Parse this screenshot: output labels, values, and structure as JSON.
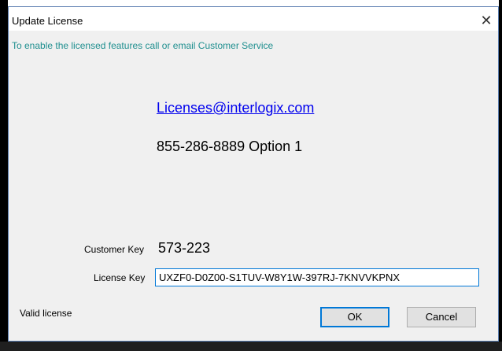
{
  "window": {
    "title": "Update License",
    "close_glyph": "✕"
  },
  "info_text": "To enable the licensed features call or email Customer Service",
  "contact": {
    "email": "Licenses@interlogix.com",
    "phone": "855-286-8889 Option 1"
  },
  "customer_key": {
    "label": "Customer Key",
    "value": "573-223"
  },
  "license_key": {
    "label": "License Key",
    "value": "UXZF0-D0Z00-S1TUV-W8Y1W-397RJ-7KNVVKPNX"
  },
  "status_text": "Valid license",
  "buttons": {
    "ok": "OK",
    "cancel": "Cancel"
  },
  "colors": {
    "info_text": "#1f8f8f",
    "link": "#0000ee",
    "focus_accent": "#0078d7"
  },
  "icons": {
    "close": "close-icon"
  }
}
